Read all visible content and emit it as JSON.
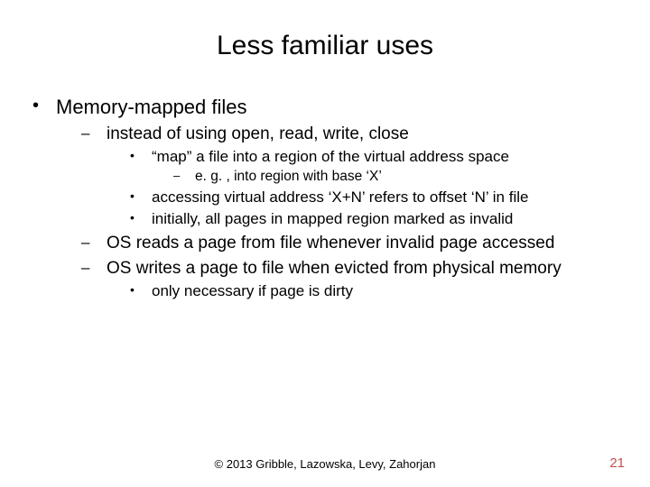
{
  "title": "Less familiar uses",
  "bullets": {
    "l1_1": "Memory-mapped files",
    "l2_1": "instead of using open, read, write, close",
    "l3_1": "“map” a file into a region of the virtual address space",
    "l4_1": "e. g. , into region with base ‘X’",
    "l3_2": "accessing virtual address ‘X+N’ refers to offset ‘N’ in file",
    "l3_3": "initially, all pages in mapped region marked as invalid",
    "l2_2": "OS reads a page from file whenever invalid page accessed",
    "l2_3": "OS writes a page to file when evicted from physical memory",
    "l3_4": "only necessary if page is dirty"
  },
  "glyph": {
    "disc": "•",
    "dash": "–"
  },
  "footer": "© 2013 Gribble, Lazowska, Levy, Zahorjan",
  "page": "21"
}
